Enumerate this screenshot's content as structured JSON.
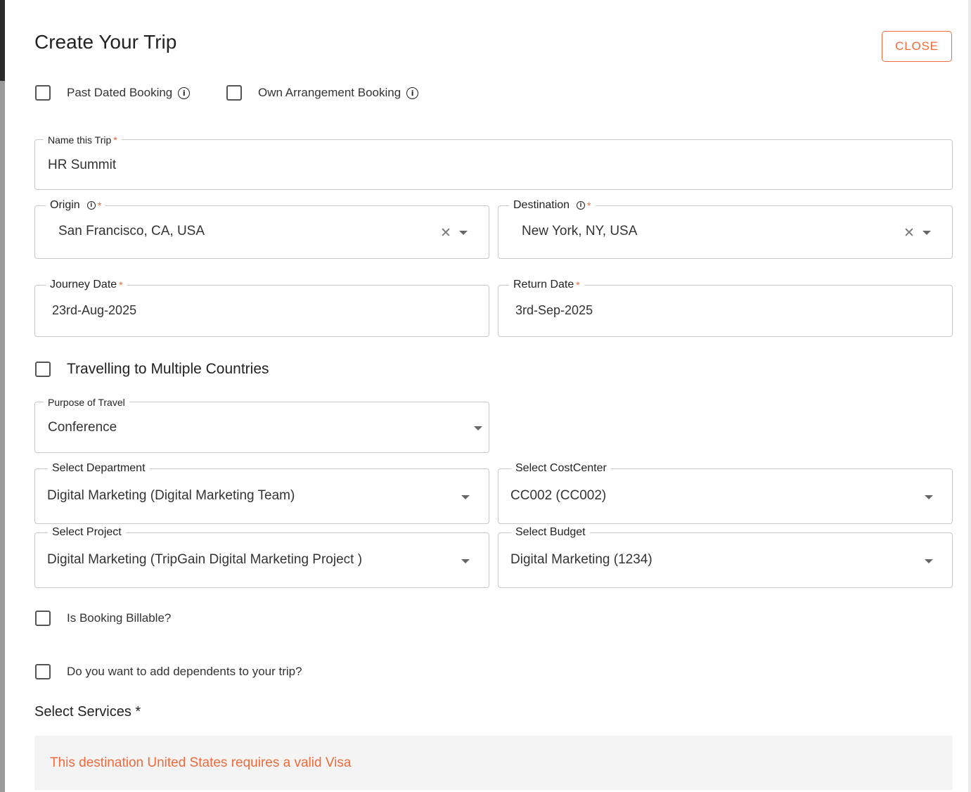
{
  "dialog": {
    "title": "Create Your Trip",
    "close_label": "CLOSE"
  },
  "top_options": {
    "past_dated_booking": {
      "label": "Past Dated Booking",
      "checked": false,
      "info_icon": "info-circle-icon"
    },
    "own_arrangement_booking": {
      "label": "Own Arrangement Booking",
      "checked": false,
      "info_icon": "info-circle-icon"
    }
  },
  "trip_name": {
    "label": "Name this Trip",
    "required_mark": "*",
    "value": "HR Summit"
  },
  "origin": {
    "label": "Origin",
    "required_mark": "*",
    "value": "San Francisco, CA, USA",
    "clear_icon": "close-icon",
    "dropdown_icon": "caret-down-icon"
  },
  "destination": {
    "label": "Destination",
    "required_mark": "*",
    "value": "New York, NY, USA",
    "clear_icon": "close-icon",
    "dropdown_icon": "caret-down-icon"
  },
  "journey_date": {
    "label": "Journey Date",
    "required_mark": "*",
    "value": "23rd-Aug-2025"
  },
  "return_date": {
    "label": "Return Date",
    "required_mark": "*",
    "value": "3rd-Sep-2025"
  },
  "multiple_countries": {
    "label": "Travelling to Multiple Countries",
    "checked": false
  },
  "purpose": {
    "label": "Purpose of Travel",
    "value": "Conference"
  },
  "department": {
    "label": "Select Department",
    "value": "Digital Marketing (Digital Marketing Team)"
  },
  "cost_center": {
    "label": "Select CostCenter",
    "value": "CC002 (CC002)"
  },
  "project": {
    "label": "Select Project",
    "value": "Digital Marketing (TripGain Digital Marketing Project )"
  },
  "budget": {
    "label": "Select Budget",
    "value": "Digital Marketing (1234)"
  },
  "billable": {
    "label": "Is Booking Billable?",
    "checked": false
  },
  "dependents": {
    "label": "Do you want to add dependents to your trip?",
    "checked": false
  },
  "services": {
    "label": "Select Services *",
    "visa_notice": "This destination United States requires a valid Visa"
  },
  "colors": {
    "accent": "#f06a3c",
    "border": "#c8c8c8",
    "notice_bg": "#f4f4f4"
  }
}
